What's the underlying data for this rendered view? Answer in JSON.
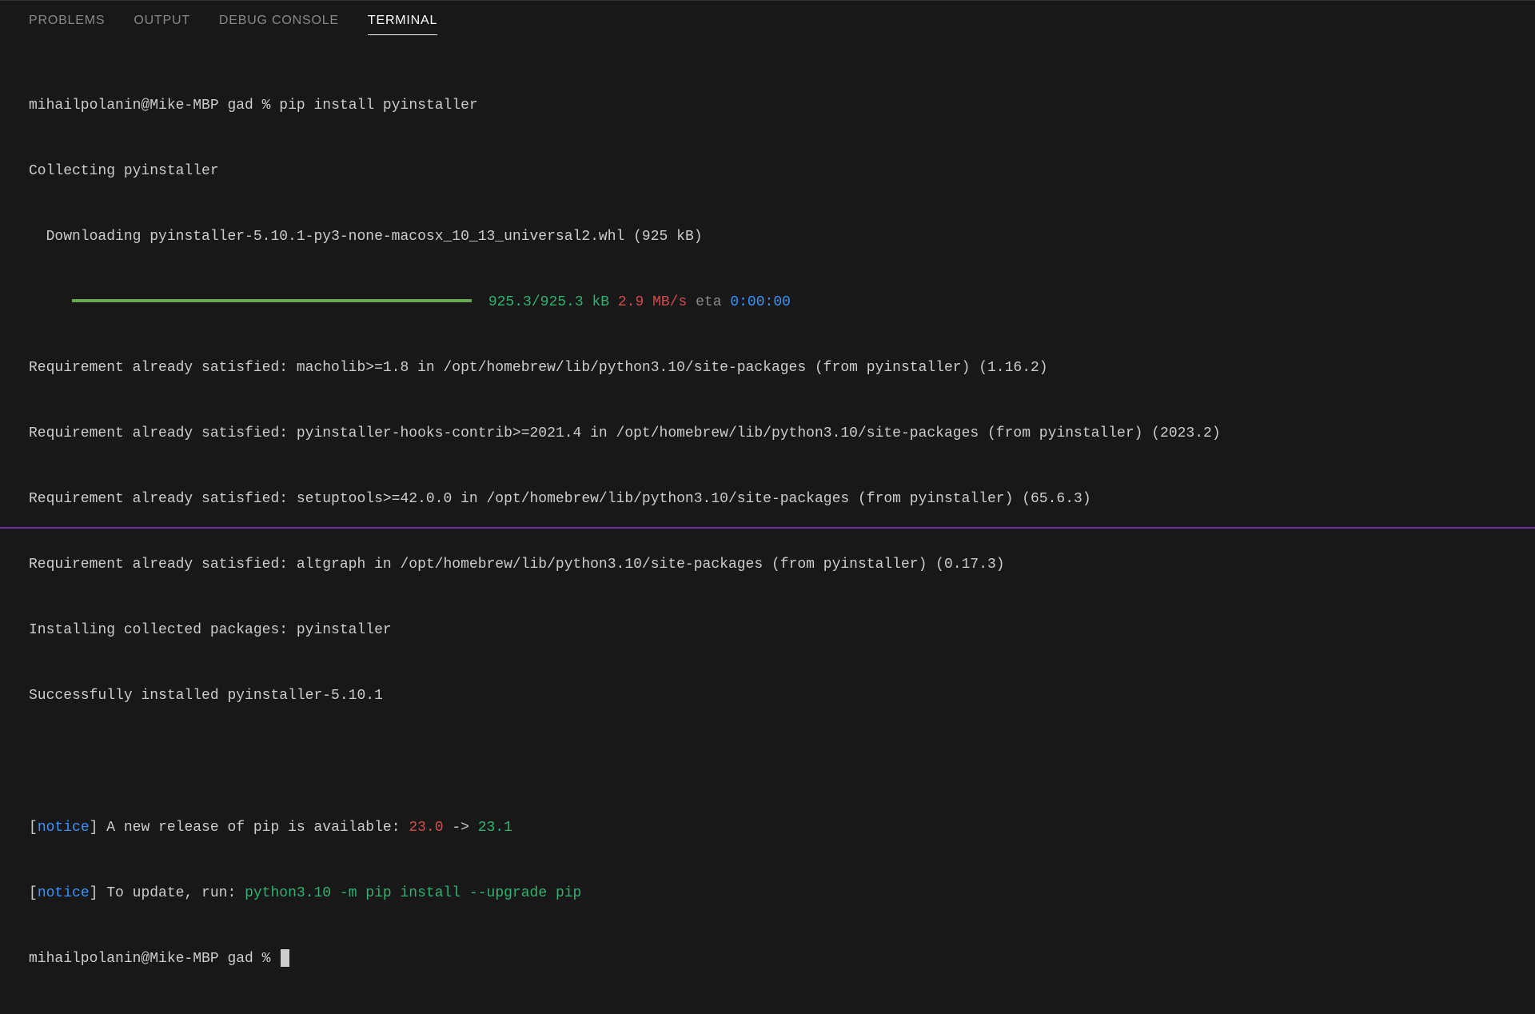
{
  "tabs": {
    "problems": "PROBLEMS",
    "output": "OUTPUT",
    "debug": "DEBUG CONSOLE",
    "terminal": "TERMINAL"
  },
  "prompt1": {
    "userhost": "mihailpolanin@Mike-MBP",
    "cwd": "gad",
    "sep": "%",
    "cmd": "pip install pyinstaller"
  },
  "out": {
    "collecting": "Collecting pyinstaller",
    "downloading": "  Downloading pyinstaller-5.10.1-py3-none-macosx_10_13_universal2.whl (925 kB)",
    "progress_indent": "     ",
    "progress_size": "925.3/925.3 kB",
    "progress_speed": "2.9 MB/s",
    "progress_eta_label": "eta",
    "progress_eta_time": "0:00:00",
    "req1": "Requirement already satisfied: macholib>=1.8 in /opt/homebrew/lib/python3.10/site-packages (from pyinstaller) (1.16.2)",
    "req2": "Requirement already satisfied: pyinstaller-hooks-contrib>=2021.4 in /opt/homebrew/lib/python3.10/site-packages (from pyinstaller) (2023.2)",
    "req3": "Requirement already satisfied: setuptools>=42.0.0 in /opt/homebrew/lib/python3.10/site-packages (from pyinstaller) (65.6.3)",
    "req4": "Requirement already satisfied: altgraph in /opt/homebrew/lib/python3.10/site-packages (from pyinstaller) (0.17.3)",
    "installing": "Installing collected packages: pyinstaller",
    "success": "Successfully installed pyinstaller-5.10.1",
    "notice_bracket_open": "[",
    "notice_bracket_close": "]",
    "notice_word": "notice",
    "notice1_text": " A new release of pip is available: ",
    "notice1_oldver": "23.0",
    "notice1_arrow": " -> ",
    "notice1_newver": "23.1",
    "notice2_text": " To update, run: ",
    "notice2_cmd": "python3.10 -m pip install --upgrade pip"
  },
  "prompt2": {
    "userhost": "mihailpolanin@Mike-MBP",
    "cwd": "gad",
    "sep": "%"
  }
}
